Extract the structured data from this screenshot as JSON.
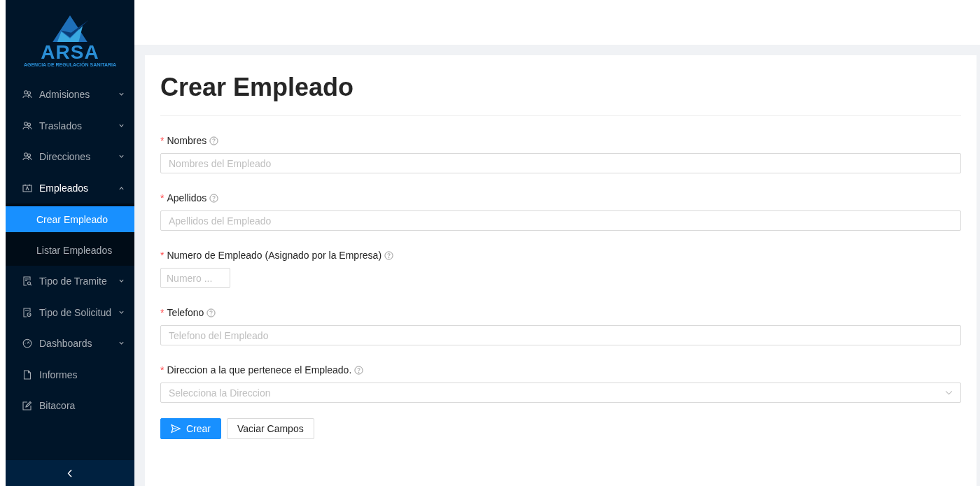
{
  "logo": {
    "name": "ARSA",
    "subtitle": "AGENCIA DE REGULACIÓN SANITARIA"
  },
  "sidebar": {
    "items": [
      {
        "label": "Admisiones",
        "expanded": false
      },
      {
        "label": "Traslados",
        "expanded": false
      },
      {
        "label": "Direcciones",
        "expanded": false
      },
      {
        "label": "Empleados",
        "expanded": true,
        "children": [
          {
            "label": "Crear Empleado",
            "selected": true
          },
          {
            "label": "Listar Empleados",
            "selected": false
          }
        ]
      },
      {
        "label": "Tipo de Tramite",
        "expanded": false
      },
      {
        "label": "Tipo de Solicitud",
        "expanded": false
      },
      {
        "label": "Dashboards",
        "expanded": false
      },
      {
        "label": "Informes"
      },
      {
        "label": "Bitacora"
      }
    ]
  },
  "form": {
    "title": "Crear Empleado",
    "fields": [
      {
        "label": "Nombres",
        "required_mark": "*",
        "kind": "text",
        "placeholder": "Nombres del Empleado"
      },
      {
        "label": "Apellidos",
        "required_mark": "*",
        "kind": "text",
        "placeholder": "Apellidos del Empleado"
      },
      {
        "label": "Numero de Empleado (Asignado por la Empresa)",
        "required_mark": "*",
        "kind": "short",
        "placeholder": "Numero ..."
      },
      {
        "label": "Telefono",
        "required_mark": "*",
        "kind": "text",
        "placeholder": "Telefono del Empleado"
      },
      {
        "label": "Direccion a la que pertenece el Empleado.",
        "required_mark": "*",
        "kind": "select",
        "placeholder": "Selecciona la Direccion"
      }
    ],
    "buttons": [
      {
        "label": "Crear",
        "kind": "primary"
      },
      {
        "label": "Vaciar Campos",
        "kind": "default"
      }
    ]
  }
}
